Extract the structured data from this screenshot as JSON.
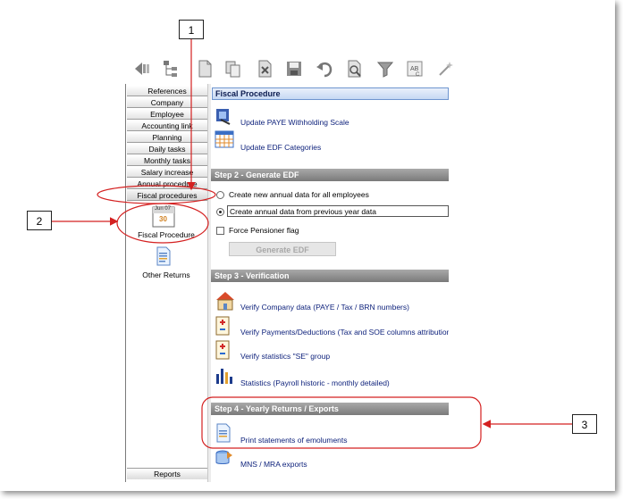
{
  "nav": {
    "items": [
      {
        "label": "References"
      },
      {
        "label": "Company"
      },
      {
        "label": "Employee"
      },
      {
        "label": "Accounting link"
      },
      {
        "label": "Planning"
      },
      {
        "label": "Daily tasks"
      },
      {
        "label": "Monthly tasks"
      },
      {
        "label": "Salary increase"
      },
      {
        "label": "Annual procedure"
      },
      {
        "label": "Fiscal procedures"
      }
    ],
    "panel_items": [
      {
        "label": "Fiscal Procedure"
      },
      {
        "label": "Other Returns"
      }
    ],
    "calendar_badge": {
      "month": "Jun 07",
      "day": "30"
    },
    "bottom_label": "Reports"
  },
  "main": {
    "section1": {
      "title": "Fiscal Procedure",
      "links": [
        {
          "label": "Update PAYE Withholding Scale"
        },
        {
          "label": "Update EDF Categories"
        }
      ]
    },
    "section2": {
      "title": "Step 2 - Generate EDF",
      "radio_new": "Create new annual data for all employees",
      "radio_prev": "Create annual data from previous year data",
      "checkbox": "Force Pensioner flag",
      "button": "Generate EDF"
    },
    "section3": {
      "title": "Step 3 - Verification",
      "links": [
        {
          "label": "Verify Company data (PAYE / Tax / BRN numbers)"
        },
        {
          "label": "Verify Payments/Deductions (Tax and SOE columns attributions)"
        },
        {
          "label": "Verify statistics \"SE\" group"
        },
        {
          "label": "Statistics (Payroll historic - monthly detailed)"
        }
      ]
    },
    "section4": {
      "title": "Step 4 - Yearly Returns / Exports",
      "links": [
        {
          "label": "Print statements of emoluments"
        },
        {
          "label": "MNS / MRA exports"
        }
      ]
    }
  },
  "annotations": {
    "callout1": "1",
    "callout2": "2",
    "callout3": "3",
    "color": "#d42020"
  }
}
